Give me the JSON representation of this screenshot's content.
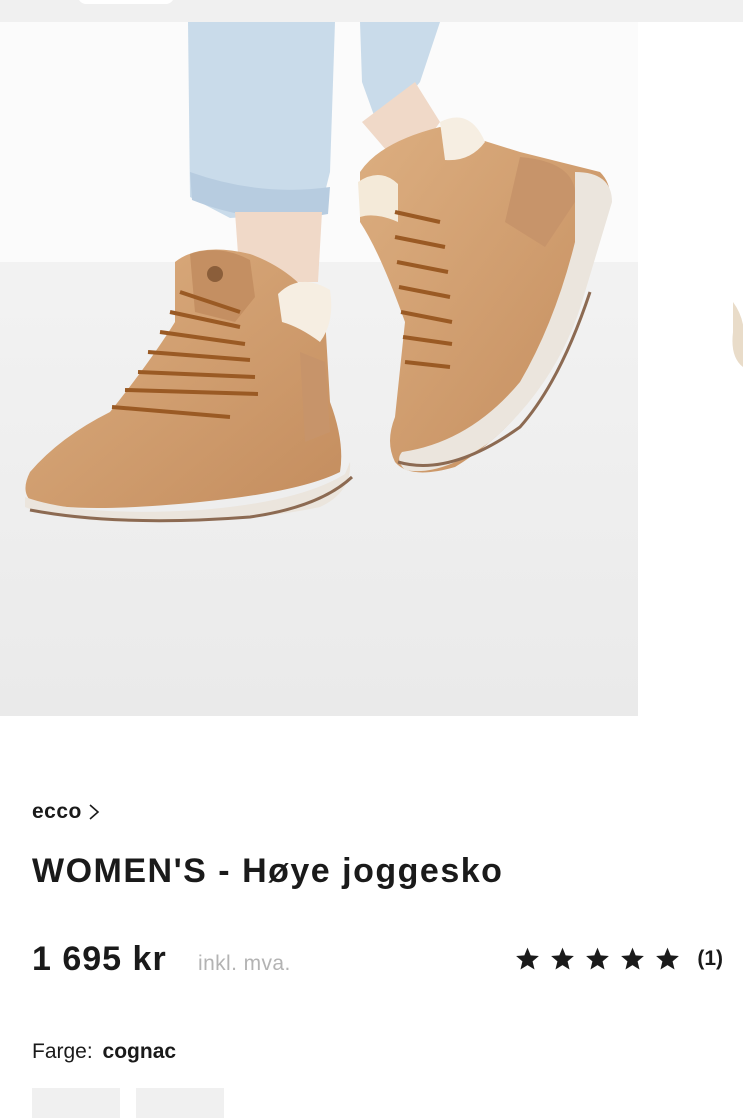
{
  "product": {
    "brand": "ecco",
    "title": "WOMEN'S - Høye joggesko",
    "price": "1 695 kr",
    "vat_note": "inkl. mva.",
    "rating": {
      "stars": 5,
      "count_label": "(1)"
    },
    "color": {
      "label": "Farge:",
      "value": "cognac"
    },
    "swatches": [
      {
        "name": "cognac"
      },
      {
        "name": "alternate-color"
      }
    ]
  },
  "gallery": {
    "image_alt": "Product image",
    "colors": {
      "boot": "#d5a072",
      "boot_dark": "#b9855a",
      "sole": "#eee9e3",
      "denim": "#c9dbea",
      "background": "#f4f4f4"
    }
  },
  "icons": {
    "brand_chevron": "chevron-right-icon",
    "star": "star-icon"
  }
}
